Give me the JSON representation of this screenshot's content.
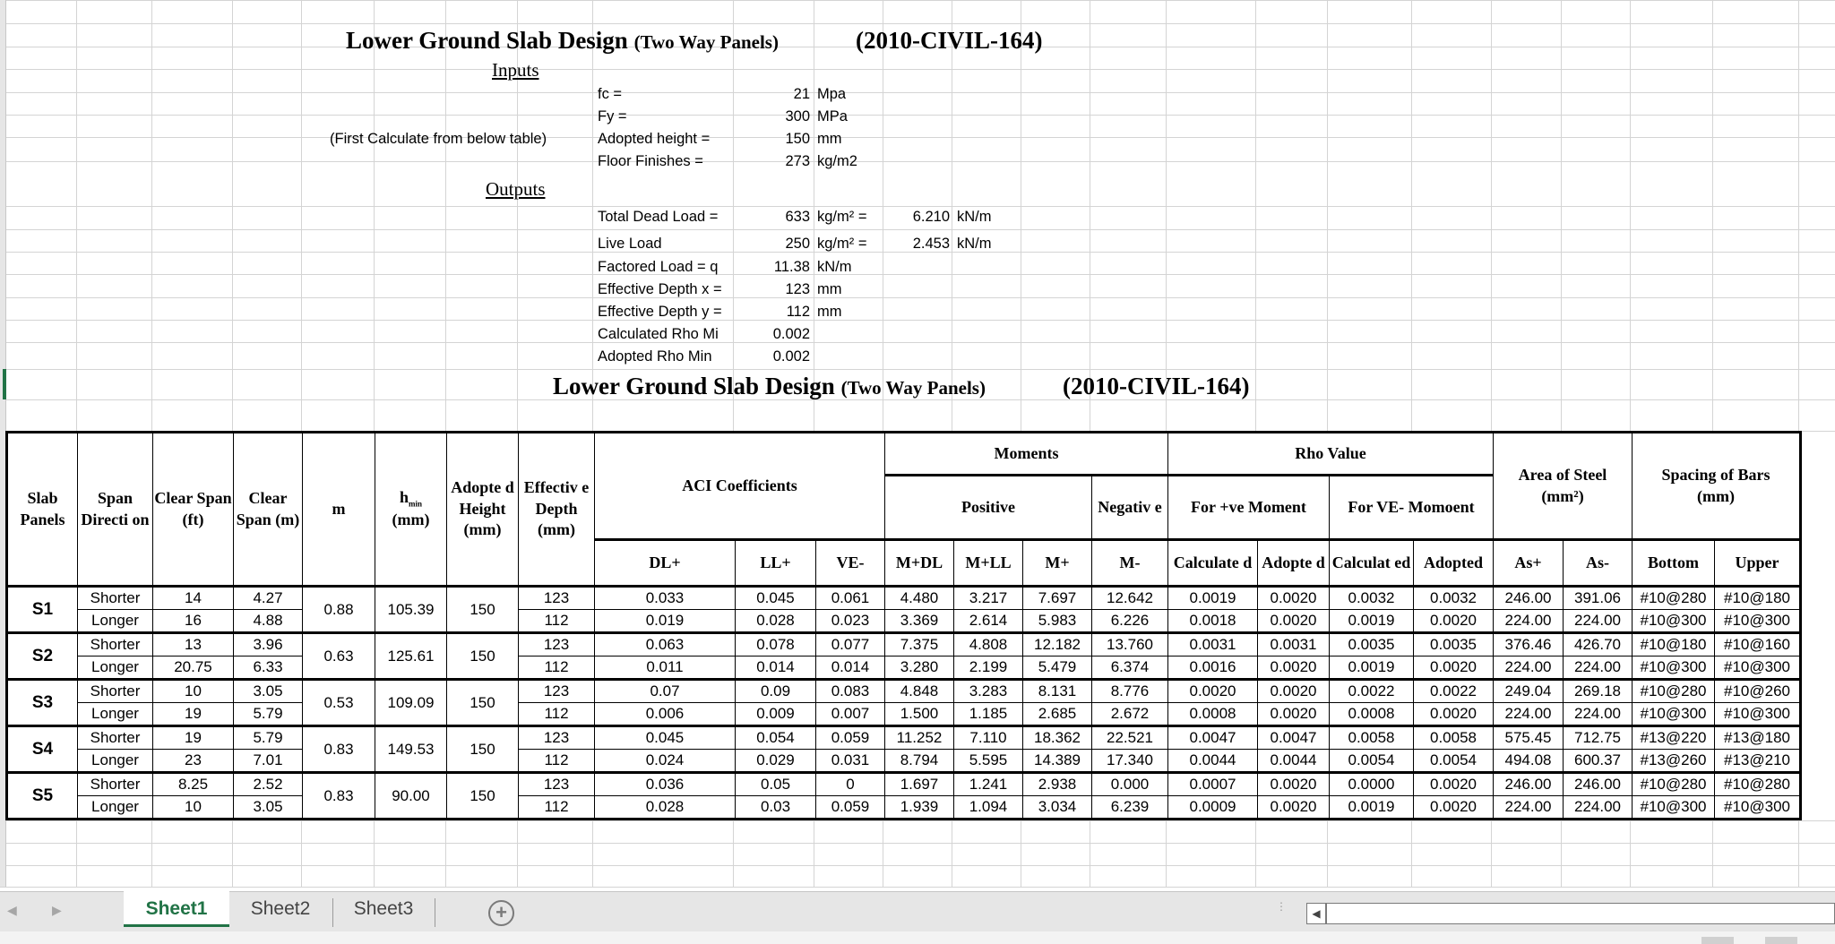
{
  "header": {
    "title_main": "Lower Ground Slab Design",
    "title_sub": "(Two Way Panels)",
    "title_code": "(2010-CIVIL-164)"
  },
  "inputs": {
    "section_label": "Inputs",
    "note": "(First Calculate from below table)",
    "rows": [
      {
        "label": "fc =",
        "value": "21",
        "unit": "Mpa"
      },
      {
        "label": "Fy =",
        "value": "300",
        "unit": "MPa"
      },
      {
        "label": "Adopted height =",
        "value": "150",
        "unit": "mm"
      },
      {
        "label": "Floor Finishes =",
        "value": "273",
        "unit": "kg/m2"
      }
    ]
  },
  "outputs": {
    "section_label": "Outputs",
    "rows": [
      {
        "label": "Total Dead Load =",
        "value": "633",
        "unit": "kg/m² =",
        "value2": "6.210",
        "unit2": "kN/m"
      },
      {
        "label": "Live Load",
        "value": "250",
        "unit": "kg/m² =",
        "value2": "2.453",
        "unit2": "kN/m"
      },
      {
        "label": "Factored Load = q",
        "value": "11.38",
        "unit": "kN/m"
      },
      {
        "label": "Effective Depth x =",
        "value": "123",
        "unit": "mm"
      },
      {
        "label": "Effective Depth y =",
        "value": "112",
        "unit": "mm"
      },
      {
        "label": "Calculated Rho Mi",
        "value": "0.002"
      },
      {
        "label": "Adopted Rho Min",
        "value": "0.002"
      }
    ]
  },
  "table_title": {
    "main": "Lower Ground Slab Design",
    "sub": "(Two Way Panels)",
    "code": "(2010-CIVIL-164)"
  },
  "table": {
    "headers": {
      "slab_panels": "Slab Panels",
      "span_direction": "Span Directi on",
      "clear_span_ft": "Clear Span (ft)",
      "clear_span_m": "Clear Span (m)",
      "m": "m",
      "hmin_h": "h",
      "hmin_sub": "min",
      "hmin_unit": "(mm)",
      "adopted_height": "Adopte d Height (mm)",
      "effective_depth": "Effectiv e Depth (mm)",
      "aci": "ACI Coefficients",
      "moments": "Moments",
      "positive": "Positive",
      "negative": "Negativ e",
      "rho_value": "Rho Value",
      "for_pos": "For +ve Moment",
      "for_neg": "For VE- Momoent",
      "area_steel": "Area of Steel",
      "area_unit": "(mm²)",
      "spacing": "Spacing of Bars",
      "spacing_unit": "(mm)",
      "dl": "DL+",
      "ll": "LL+",
      "ve": "VE-",
      "mdl": "M+DL",
      "mll": "M+LL",
      "mp": "M+",
      "mn": "M-",
      "calc1": "Calculate d",
      "adopt1": "Adopte d",
      "calc2": "Calculat ed",
      "adopt2": "Adopted",
      "asp": "As+",
      "asn": "As-",
      "bottom": "Bottom",
      "upper": "Upper"
    },
    "panels": [
      {
        "name": "S1",
        "m": "0.88",
        "hmin": "105.39",
        "adopted": "150",
        "rows": [
          {
            "dir": "Shorter",
            "ft": "14",
            "mm": "4.27",
            "d": "123",
            "dl": "0.033",
            "ll": "0.045",
            "ve": "0.061",
            "mdl": "4.480",
            "mll": "3.217",
            "mp": "7.697",
            "mn": "12.642",
            "c1": "0.0019",
            "a1": "0.0020",
            "c2": "0.0032",
            "a2": "0.0032",
            "asp": "246.00",
            "asn": "391.06",
            "bot": "#10@280",
            "up": "#10@180"
          },
          {
            "dir": "Longer",
            "ft": "16",
            "mm": "4.88",
            "d": "112",
            "dl": "0.019",
            "ll": "0.028",
            "ve": "0.023",
            "mdl": "3.369",
            "mll": "2.614",
            "mp": "5.983",
            "mn": "6.226",
            "c1": "0.0018",
            "a1": "0.0020",
            "c2": "0.0019",
            "a2": "0.0020",
            "asp": "224.00",
            "asn": "224.00",
            "bot": "#10@300",
            "up": "#10@300"
          }
        ]
      },
      {
        "name": "S2",
        "m": "0.63",
        "hmin": "125.61",
        "adopted": "150",
        "rows": [
          {
            "dir": "Shorter",
            "ft": "13",
            "mm": "3.96",
            "d": "123",
            "dl": "0.063",
            "ll": "0.078",
            "ve": "0.077",
            "mdl": "7.375",
            "mll": "4.808",
            "mp": "12.182",
            "mn": "13.760",
            "c1": "0.0031",
            "a1": "0.0031",
            "c2": "0.0035",
            "a2": "0.0035",
            "asp": "376.46",
            "asn": "426.70",
            "bot": "#10@180",
            "up": "#10@160"
          },
          {
            "dir": "Longer",
            "ft": "20.75",
            "mm": "6.33",
            "d": "112",
            "dl": "0.011",
            "ll": "0.014",
            "ve": "0.014",
            "mdl": "3.280",
            "mll": "2.199",
            "mp": "5.479",
            "mn": "6.374",
            "c1": "0.0016",
            "a1": "0.0020",
            "c2": "0.0019",
            "a2": "0.0020",
            "asp": "224.00",
            "asn": "224.00",
            "bot": "#10@300",
            "up": "#10@300"
          }
        ]
      },
      {
        "name": "S3",
        "m": "0.53",
        "hmin": "109.09",
        "adopted": "150",
        "rows": [
          {
            "dir": "Shorter",
            "ft": "10",
            "mm": "3.05",
            "d": "123",
            "dl": "0.07",
            "ll": "0.09",
            "ve": "0.083",
            "mdl": "4.848",
            "mll": "3.283",
            "mp": "8.131",
            "mn": "8.776",
            "c1": "0.0020",
            "a1": "0.0020",
            "c2": "0.0022",
            "a2": "0.0022",
            "asp": "249.04",
            "asn": "269.18",
            "bot": "#10@280",
            "up": "#10@260"
          },
          {
            "dir": "Longer",
            "ft": "19",
            "mm": "5.79",
            "d": "112",
            "dl": "0.006",
            "ll": "0.009",
            "ve": "0.007",
            "mdl": "1.500",
            "mll": "1.185",
            "mp": "2.685",
            "mn": "2.672",
            "c1": "0.0008",
            "a1": "0.0020",
            "c2": "0.0008",
            "a2": "0.0020",
            "asp": "224.00",
            "asn": "224.00",
            "bot": "#10@300",
            "up": "#10@300"
          }
        ]
      },
      {
        "name": "S4",
        "m": "0.83",
        "hmin": "149.53",
        "adopted": "150",
        "rows": [
          {
            "dir": "Shorter",
            "ft": "19",
            "mm": "5.79",
            "d": "123",
            "dl": "0.045",
            "ll": "0.054",
            "ve": "0.059",
            "mdl": "11.252",
            "mll": "7.110",
            "mp": "18.362",
            "mn": "22.521",
            "c1": "0.0047",
            "a1": "0.0047",
            "c2": "0.0058",
            "a2": "0.0058",
            "asp": "575.45",
            "asn": "712.75",
            "bot": "#13@220",
            "up": "#13@180"
          },
          {
            "dir": "Longer",
            "ft": "23",
            "mm": "7.01",
            "d": "112",
            "dl": "0.024",
            "ll": "0.029",
            "ve": "0.031",
            "mdl": "8.794",
            "mll": "5.595",
            "mp": "14.389",
            "mn": "17.340",
            "c1": "0.0044",
            "a1": "0.0044",
            "c2": "0.0054",
            "a2": "0.0054",
            "asp": "494.08",
            "asn": "600.37",
            "bot": "#13@260",
            "up": "#13@210"
          }
        ]
      },
      {
        "name": "S5",
        "m": "0.83",
        "hmin": "90.00",
        "adopted": "150",
        "rows": [
          {
            "dir": "Shorter",
            "ft": "8.25",
            "mm": "2.52",
            "d": "123",
            "dl": "0.036",
            "ll": "0.05",
            "ve": "0",
            "mdl": "1.697",
            "mll": "1.241",
            "mp": "2.938",
            "mn": "0.000",
            "c1": "0.0007",
            "a1": "0.0020",
            "c2": "0.0000",
            "a2": "0.0020",
            "asp": "246.00",
            "asn": "246.00",
            "bot": "#10@280",
            "up": "#10@280"
          },
          {
            "dir": "Longer",
            "ft": "10",
            "mm": "3.05",
            "d": "112",
            "dl": "0.028",
            "ll": "0.03",
            "ve": "0.059",
            "mdl": "1.939",
            "mll": "1.094",
            "mp": "3.034",
            "mn": "6.239",
            "c1": "0.0009",
            "a1": "0.0020",
            "c2": "0.0019",
            "a2": "0.0020",
            "asp": "224.00",
            "asn": "224.00",
            "bot": "#10@300",
            "up": "#10@300"
          }
        ]
      }
    ]
  },
  "sheet_tabs": {
    "tabs": [
      "Sheet1",
      "Sheet2",
      "Sheet3"
    ],
    "active": "Sheet1",
    "add_icon": "plus-circle-icon",
    "accent": "#217346"
  }
}
